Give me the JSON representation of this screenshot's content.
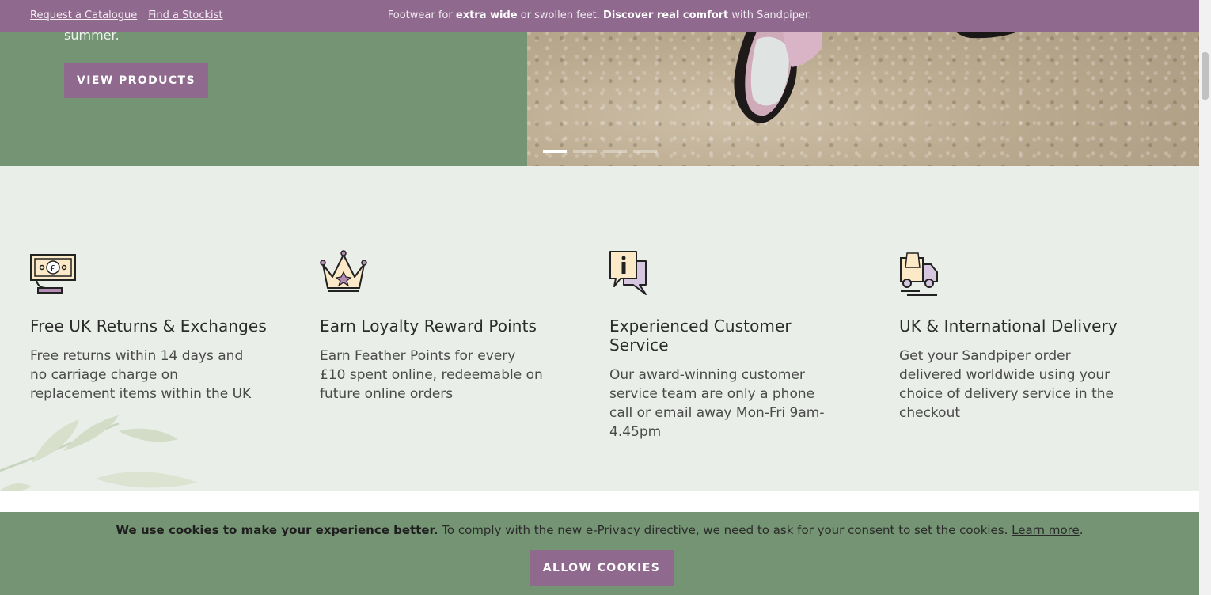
{
  "topbar": {
    "links": [
      "Request a Catalogue",
      "Find a Stockist"
    ],
    "announce_pre": "Footwear for ",
    "announce_bold1": "extra wide",
    "announce_mid": " or swollen feet. ",
    "announce_bold2": "Discover real comfort",
    "announce_post": " with Sandpiper."
  },
  "hero": {
    "copy_tail": "summer.",
    "button_label": "VIEW PRODUCTS",
    "slides_total": 4,
    "active_slide": 1
  },
  "features": [
    {
      "icon": "cash-hand-icon",
      "title": "Free UK Returns & Exchanges",
      "text": "Free returns within 14 days and no carriage charge on replacement items within the UK"
    },
    {
      "icon": "crown-icon",
      "title": "Earn Loyalty Reward Points",
      "text": "Earn Feather Points for every £10 spent online, redeemable on future online orders"
    },
    {
      "icon": "info-speech-icon",
      "title": "Experienced Customer Service",
      "text": "Our award-winning customer service team are only a phone call or email away Mon-Fri 9am-4.45pm"
    },
    {
      "icon": "delivery-van-icon",
      "title": "UK & International Delivery",
      "text": "Get your Sandpiper order delivered worldwide using your choice of delivery service in the checkout"
    }
  ],
  "cookie": {
    "bold": "We use cookies to make your experience better.",
    "text": " To comply with the new e-Privacy directive, we need to ask for your consent to set the cookies. ",
    "link": "Learn more",
    "end": ".",
    "button_label": "ALLOW COOKIES"
  },
  "colors": {
    "accent_purple": "#8f698e",
    "green": "#759474",
    "features_bg": "#e9eee8"
  }
}
